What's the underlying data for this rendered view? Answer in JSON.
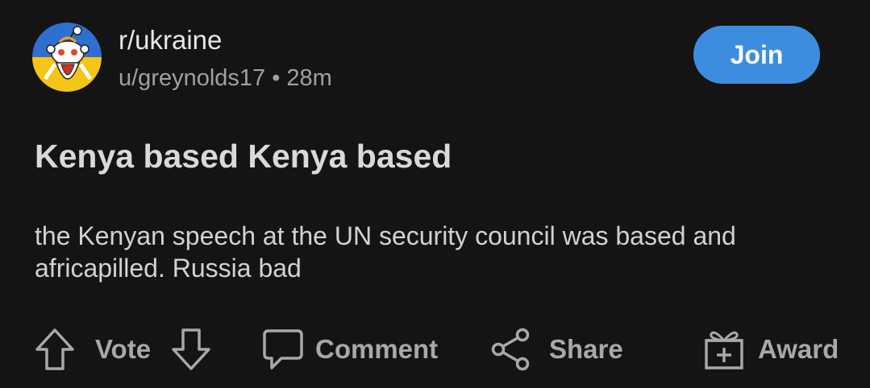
{
  "header": {
    "subreddit": "r/ukraine",
    "username": "u/greynolds17",
    "separator": "•",
    "time_ago": "28m",
    "join_label": "Join",
    "avatar_icon": "ukraine-snoo-avatar-icon"
  },
  "post": {
    "title": "Kenya based Kenya based",
    "body": "the Kenyan speech at the UN security council was based and africapilled. Russia bad"
  },
  "actions": {
    "vote_label": "Vote",
    "comment_label": "Comment",
    "share_label": "Share",
    "award_label": "Award"
  },
  "colors": {
    "background": "#141414",
    "join_button": "#3c8de0",
    "ukraine_blue": "#2e6fd0",
    "ukraine_yellow": "#f5c518"
  }
}
